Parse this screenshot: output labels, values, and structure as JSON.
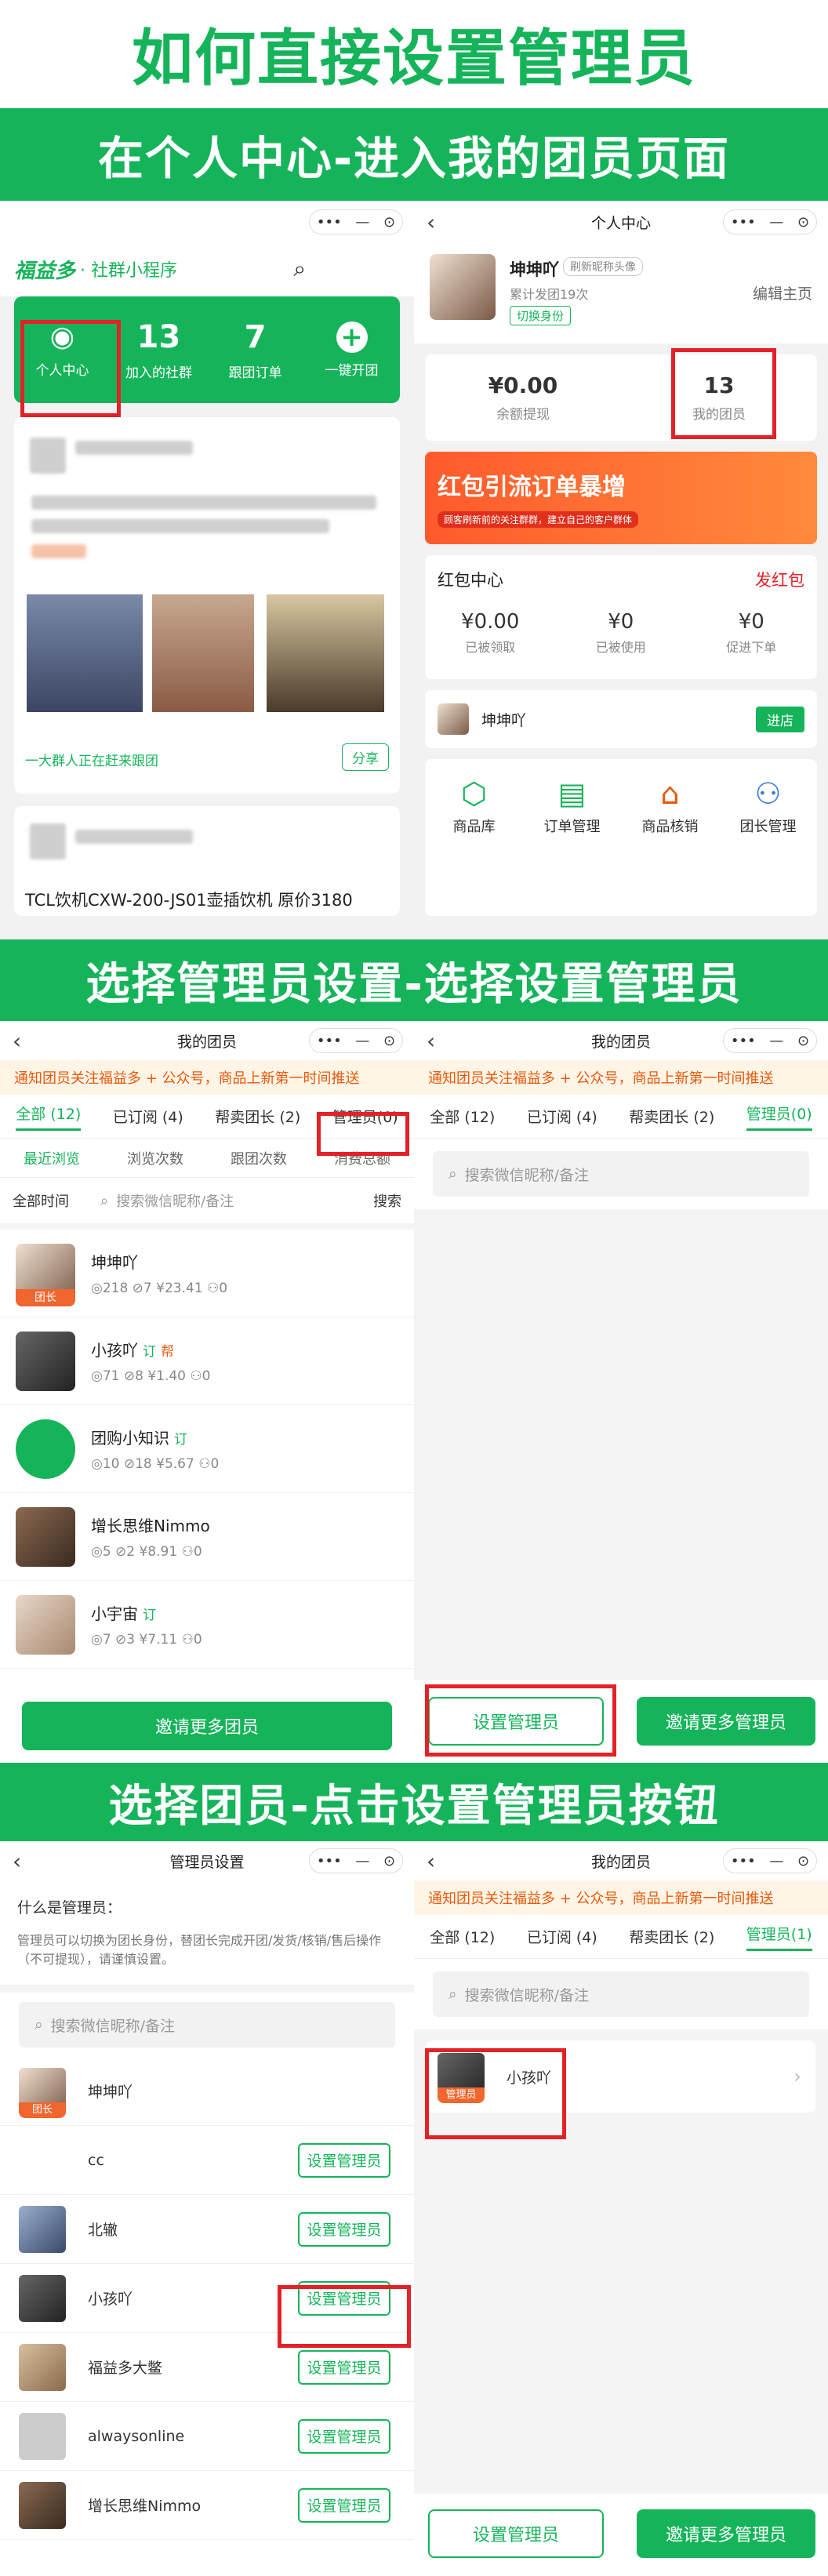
{
  "main_title": "如何直接设置管理员",
  "step1_title": "在个人中心-进入我的团员页面",
  "step2_title": "选择管理员设置-选择设置管理员",
  "step3_title": "选择团员-点击设置管理员按钮",
  "capsule": {
    "dots": "•••",
    "minus": "—",
    "target": "⊙"
  },
  "p1": {
    "logo": "福益多",
    "app_name": "· 社群小程序",
    "nav": [
      {
        "value": "",
        "label": "个人中心"
      },
      {
        "value": "13",
        "label": "加入的社群"
      },
      {
        "value": "7",
        "label": "跟团订单"
      },
      {
        "value": "+",
        "label": "一键开团"
      }
    ],
    "feed_footer": "一大群人正在赶来跟团",
    "share": "分享",
    "product_title": "TCL饮机CXW-200-JS01壶插饮机 原价3180"
  },
  "p2": {
    "title": "个人中心",
    "user_name": "坤坤吖",
    "refresh_avatar": "刷新昵称头像",
    "cumulative": "累计发团19次",
    "switch_role": "切换身份",
    "edit_home": "编辑主页",
    "balance_value": "¥0.00",
    "balance_label": "余额提现",
    "members_value": "13",
    "members_label": "我的团员",
    "banner_text": "红包引流订单暴增",
    "banner_sub": "顾客刷新前的关注群群，建立自己的客户群体",
    "redpack_title": "红包中心",
    "redpack_action": "发红包",
    "redpack_stats": [
      {
        "value": "¥0.00",
        "label": "已被领取"
      },
      {
        "value": "¥0",
        "label": "已被使用"
      },
      {
        "value": "¥0",
        "label": "促进下单"
      }
    ],
    "shop_user": "坤坤吖",
    "enter_shop": "进店",
    "functions": [
      {
        "icon": "box-icon",
        "label": "商品库"
      },
      {
        "icon": "order-icon",
        "label": "订单管理"
      },
      {
        "icon": "bag-icon",
        "label": "商品核销"
      },
      {
        "icon": "leader-icon",
        "label": "团长管理"
      }
    ]
  },
  "p3": {
    "title": "我的团员",
    "notice": "通知团员关注福益多 + 公众号，商品上新第一时间推送",
    "tabs": [
      "全部 (12)",
      "已订阅 (4)",
      "帮卖团长 (2)",
      "管理员(0)"
    ],
    "sort": [
      "最近浏览",
      "浏览次数",
      "跟团次数",
      "消费总额"
    ],
    "time_filter": "全部时间",
    "search_placeholder": "搜索微信昵称/备注",
    "search_btn": "搜索",
    "members": [
      {
        "name": "坤坤吖",
        "stats": "◎218  ⊘7  ¥23.41  ⚇0",
        "badge": "团长",
        "tag_g": "",
        "tag_r": ""
      },
      {
        "name": "小孩吖",
        "stats": "◎71  ⊘8  ¥1.40  ⚇0",
        "badge": "",
        "tag_g": "订",
        "tag_r": "帮"
      },
      {
        "name": "团购小知识",
        "stats": "◎10  ⊘18  ¥5.67  ⚇0",
        "badge": "",
        "tag_g": "订",
        "tag_r": ""
      },
      {
        "name": "增长思维Nimmo",
        "stats": "◎5  ⊘2  ¥8.91  ⚇0",
        "badge": "",
        "tag_g": "",
        "tag_r": ""
      },
      {
        "name": "小宇宙",
        "stats": "◎7  ⊘3  ¥7.11  ⚇0",
        "badge": "",
        "tag_g": "订",
        "tag_r": ""
      }
    ],
    "invite": "邀请更多团员"
  },
  "p4": {
    "title": "我的团员",
    "tabs": [
      "全部 (12)",
      "已订阅 (4)",
      "帮卖团长 (2)",
      "管理员(0)"
    ],
    "set_admin": "设置管理员",
    "invite_admin": "邀请更多管理员"
  },
  "p5": {
    "title": "管理员设置",
    "what_title": "什么是管理员：",
    "what_desc": "管理员可以切换为团长身份，替团长完成开团/发货/核销/售后操作（不可提现），请谨慎设置。",
    "rows": [
      {
        "name": "坤坤吖",
        "badge": "团长",
        "btn": ""
      },
      {
        "name": "cc",
        "badge": "",
        "btn": "设置管理员"
      },
      {
        "name": "北辙",
        "badge": "",
        "btn": "设置管理员"
      },
      {
        "name": "小孩吖",
        "badge": "",
        "btn": "设置管理员"
      },
      {
        "name": "福益多大鳖",
        "badge": "",
        "btn": "设置管理员"
      },
      {
        "name": "alwaysonline",
        "badge": "",
        "btn": "设置管理员"
      },
      {
        "name": "增长思维Nimmo",
        "badge": "",
        "btn": "设置管理员"
      }
    ]
  },
  "p6": {
    "title": "我的团员",
    "tabs": [
      "全部 (12)",
      "已订阅 (4)",
      "帮卖团长 (2)",
      "管理员(1)"
    ],
    "admin_name": "小孩吖",
    "admin_badge": "管理员"
  }
}
